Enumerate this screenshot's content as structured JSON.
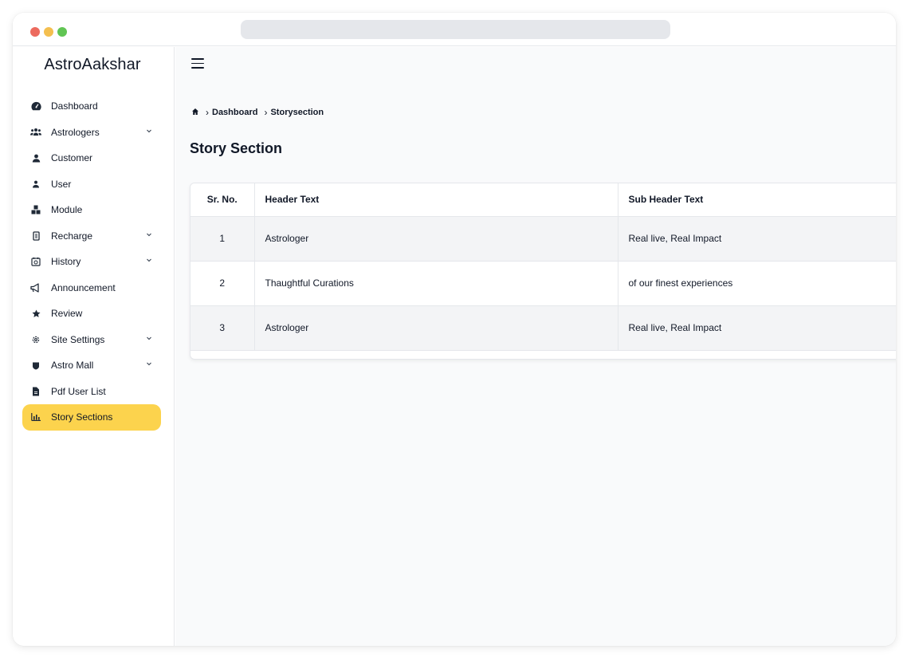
{
  "brand": {
    "name": "AstroAakshar"
  },
  "sidebar": {
    "items": [
      {
        "label": "Dashboard",
        "icon": "dashboard-icon",
        "expandable": false,
        "active": false
      },
      {
        "label": "Astrologers",
        "icon": "users-group-icon",
        "expandable": true,
        "active": false
      },
      {
        "label": "Customer",
        "icon": "customer-icon",
        "expandable": false,
        "active": false
      },
      {
        "label": "User",
        "icon": "user-icon",
        "expandable": false,
        "active": false
      },
      {
        "label": "Module",
        "icon": "module-icon",
        "expandable": false,
        "active": false
      },
      {
        "label": "Recharge",
        "icon": "recharge-icon",
        "expandable": true,
        "active": false
      },
      {
        "label": "History",
        "icon": "history-icon",
        "expandable": true,
        "active": false
      },
      {
        "label": "Announcement",
        "icon": "megaphone-icon",
        "expandable": false,
        "active": false
      },
      {
        "label": "Review",
        "icon": "star-icon",
        "expandable": false,
        "active": false
      },
      {
        "label": "Site Settings",
        "icon": "settings-icon",
        "expandable": true,
        "active": false
      },
      {
        "label": "Astro Mall",
        "icon": "shop-icon",
        "expandable": true,
        "active": false
      },
      {
        "label": "Pdf User List",
        "icon": "document-icon",
        "expandable": false,
        "active": false
      },
      {
        "label": "Story Sections",
        "icon": "bar-chart-icon",
        "expandable": false,
        "active": true
      }
    ]
  },
  "breadcrumb": {
    "items": [
      "Dashboard",
      "Storysection"
    ]
  },
  "page": {
    "title": "Story Section"
  },
  "table": {
    "headers": [
      "Sr. No.",
      "Header Text",
      "Sub Header Text"
    ],
    "rows": [
      [
        "1",
        "Astrologer",
        "Real live, Real Impact"
      ],
      [
        "2",
        "Thaughtful Curations",
        "of our finest experiences"
      ],
      [
        "3",
        "Astrologer",
        "Real live, Real Impact"
      ]
    ]
  },
  "colors": {
    "active_nav": "#fcd34d",
    "traffic_red": "#ec6a5e",
    "traffic_yellow": "#f4bf4f",
    "traffic_green": "#61c554"
  }
}
